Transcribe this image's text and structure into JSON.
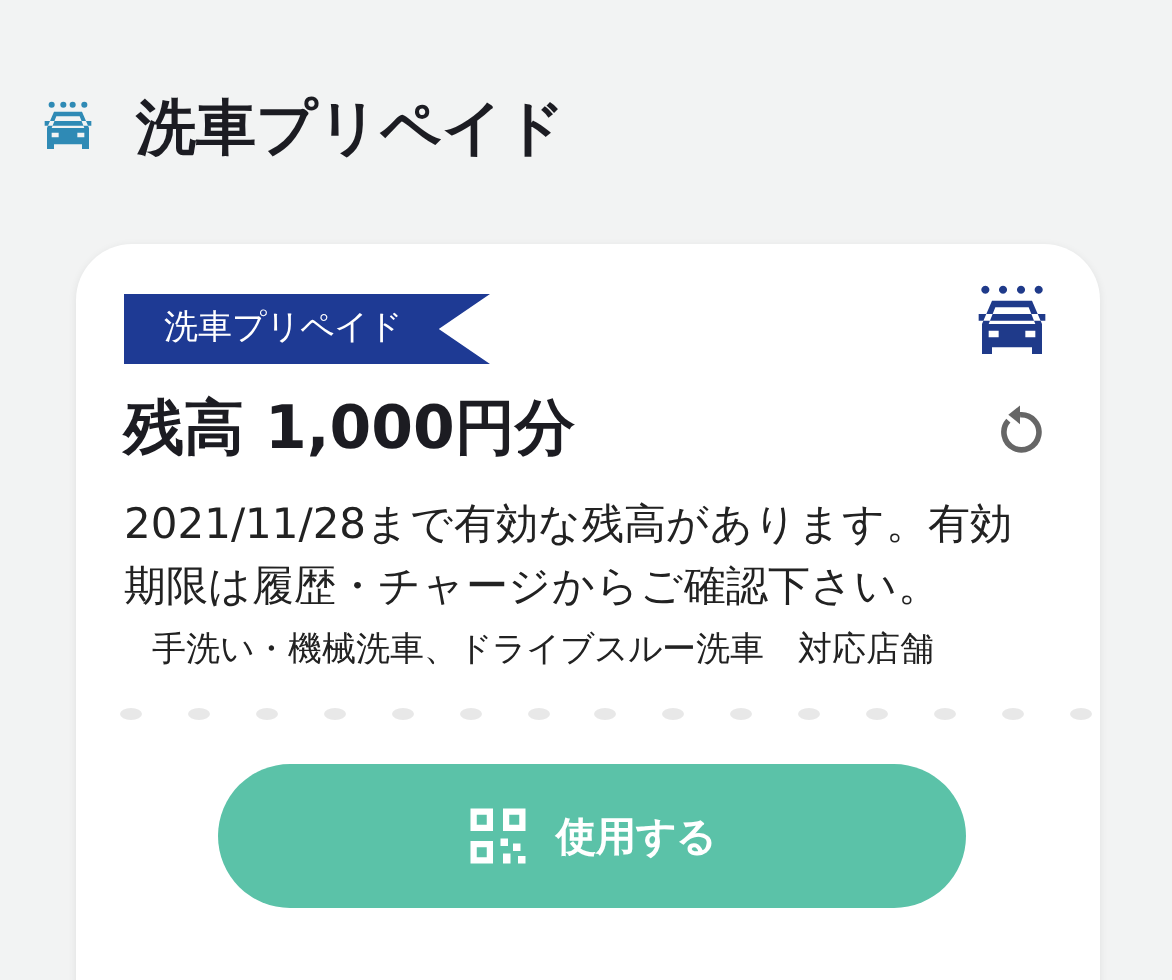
{
  "header": {
    "title": "洗車プリペイド"
  },
  "card": {
    "ribbon": "洗車プリペイド",
    "balance": "残高 1,000円分",
    "description": "2021/11/28まで有効な残高があります。有効期限は履歴・チャージからご確認下さい。",
    "stores": "手洗い・機械洗車、ドライブスルー洗車　対応店舗",
    "button": "使用する"
  }
}
